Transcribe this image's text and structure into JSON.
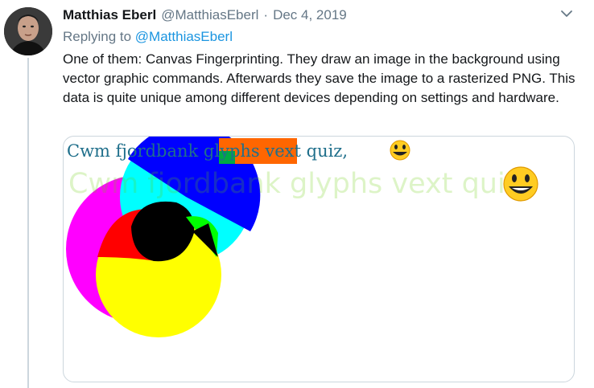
{
  "tweet": {
    "author_name": "Matthias Eberl",
    "author_handle": "@MatthiasEberl",
    "separator": "·",
    "date": "Dec 4, 2019",
    "reply_prefix": "Replying to",
    "reply_to": "@MatthiasEberl",
    "text": "One of them: Canvas Fingerprinting. They draw an image in the background using vector graphic commands. Afterwards they save the image to a rasterized PNG. This data is quite unique among different devices depending on settings and hardware."
  },
  "media": {
    "fingerprint_text_top": "Cwm fjordbank glyphs vext quiz,",
    "fingerprint_text_large": "Cwm fjordbank glyphs vext quiz,",
    "colors": {
      "magenta": "#ff00ff",
      "cyan": "#00ffff",
      "yellow": "#ffff00",
      "blue": "#0000ff",
      "red": "#ff0000",
      "green": "#00ff00",
      "orange": "#ff6600",
      "text_teal": "#1f6f8b",
      "text_light_green": "rgba(102,204,0,0.2)"
    }
  },
  "icons": {
    "caret": "chevron-down-icon",
    "emoji": "grinning-face-emoji-icon"
  },
  "colors": {
    "link": "#1b95e0",
    "muted": "#657786",
    "text": "#14171a",
    "border": "#ccd6dd"
  }
}
